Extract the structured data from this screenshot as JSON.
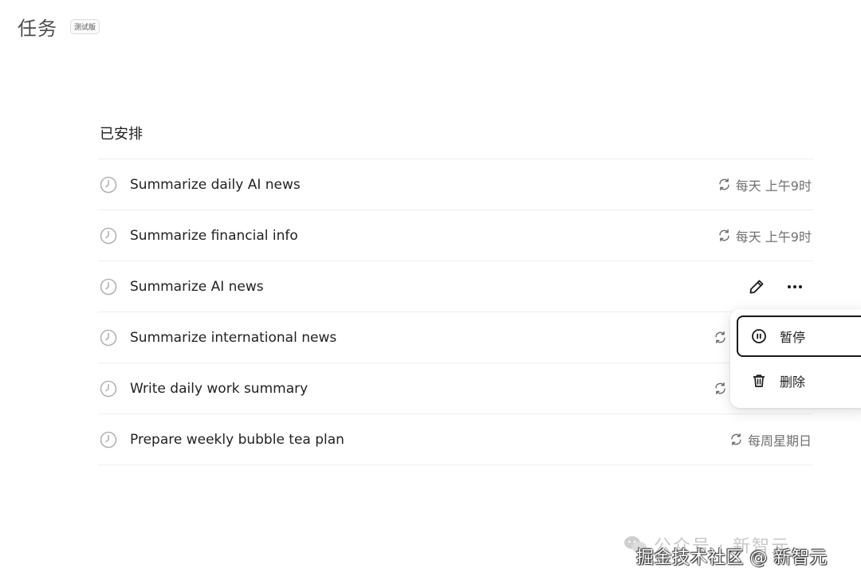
{
  "header": {
    "title": "任务",
    "badge": "测试版"
  },
  "section": {
    "title": "已安排"
  },
  "tasks": [
    {
      "name": "Summarize daily AI news",
      "schedule": "每天 上午9时"
    },
    {
      "name": "Summarize financial info",
      "schedule": "每天 上午9时"
    },
    {
      "name": "Summarize AI news",
      "schedule": ""
    },
    {
      "name": "Summarize international news",
      "schedule": ""
    },
    {
      "name": "Write daily work summary",
      "schedule": ""
    },
    {
      "name": "Prepare weekly bubble tea plan",
      "schedule": "每周星期日"
    }
  ],
  "menu": {
    "pause_label": "暂停",
    "delete_label": "删除"
  },
  "icons": {
    "task": "clock-icon",
    "schedule": "repeat-icon",
    "edit": "pencil-icon",
    "more": "more-horizontal-icon",
    "pause": "pause-circle-icon",
    "delete": "trash-icon"
  },
  "watermark": {
    "back": "公众号 · 新智元",
    "front": "掘金技术社区 @ 新智元"
  }
}
